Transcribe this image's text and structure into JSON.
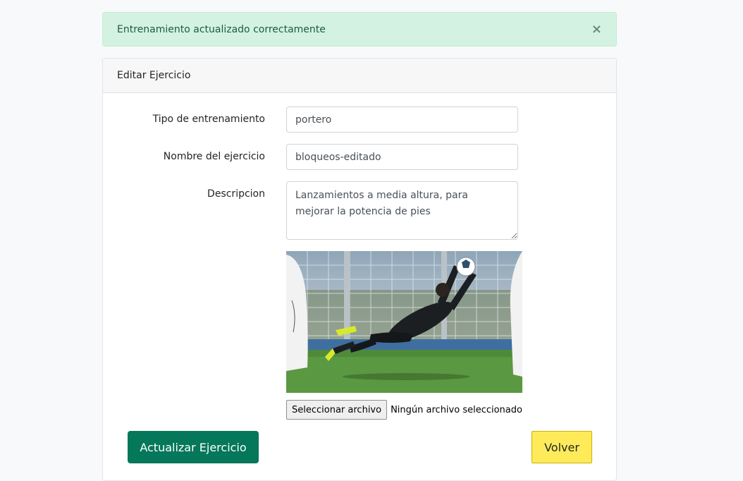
{
  "alert": {
    "message": "Entrenamiento actualizado correctamente",
    "close_symbol": "×",
    "color": "#d4f2e1"
  },
  "card": {
    "title": "Editar Ejercicio"
  },
  "form": {
    "tipo": {
      "label": "Tipo de entrenamiento",
      "value": "portero"
    },
    "nombre": {
      "label": "Nombre del ejercicio",
      "value": "bloqueos-editado"
    },
    "descripcion": {
      "label": "Descripcion",
      "value": "Lanzamientos a media altura, para mejorar la potencia de pies"
    },
    "file": {
      "button_label": "Seleccionar archivo",
      "status": "Ningún archivo seleccionado"
    }
  },
  "buttons": {
    "update_label": "Actualizar Ejercicio",
    "update_color": "#05775a",
    "back_label": "Volver",
    "back_color": "#ffeb5a"
  }
}
